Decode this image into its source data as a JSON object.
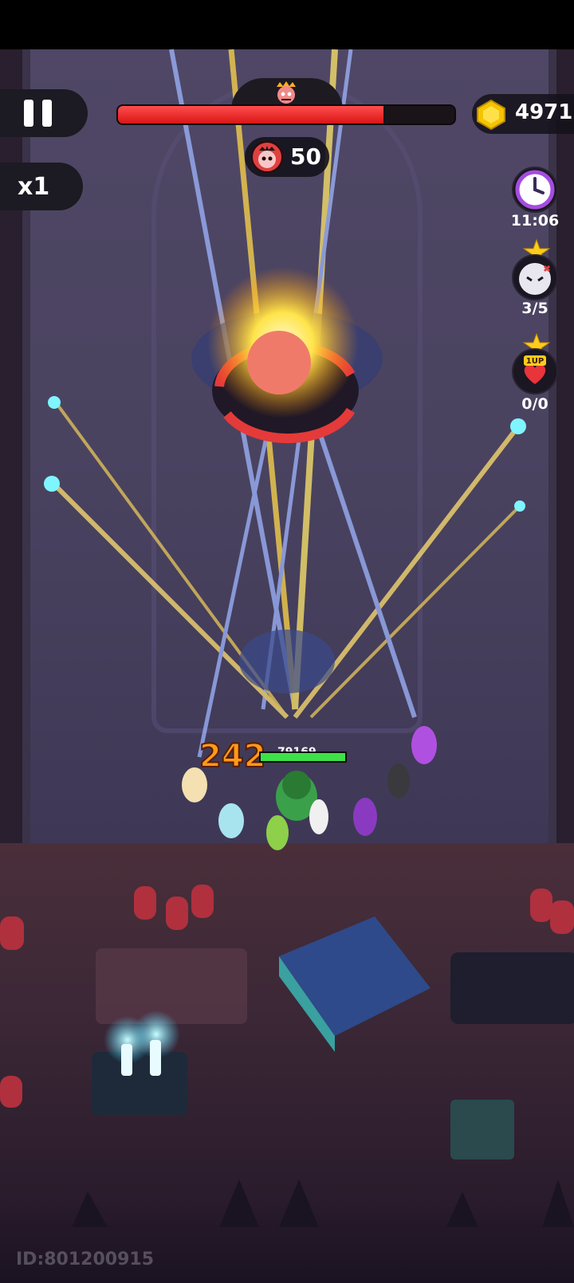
{
  "hud": {
    "pause_icon": "pause-icon",
    "speed_label": "x1",
    "coins": "4971",
    "kills": "50",
    "boss_hp_fraction": 0.79
  },
  "side_panel": {
    "timer": {
      "icon": "clock-icon",
      "value": "11:06"
    },
    "elite": {
      "icon": "elite-skull-icon",
      "value": "3/5"
    },
    "revive": {
      "icon": "1up-heart-icon",
      "label": "1UP",
      "value": "0/0"
    }
  },
  "combat": {
    "damage_number": "242",
    "player_hp_value": "79169",
    "player_hp_fraction": 1.0
  },
  "footer": {
    "player_id": "ID:801200915"
  },
  "colors": {
    "boss_hp": "#e21c1c",
    "player_hp": "#3ee04a",
    "damage_text": "#ff9a1a",
    "coin": "#f5c400",
    "timer_ring": "#a44ce0"
  }
}
